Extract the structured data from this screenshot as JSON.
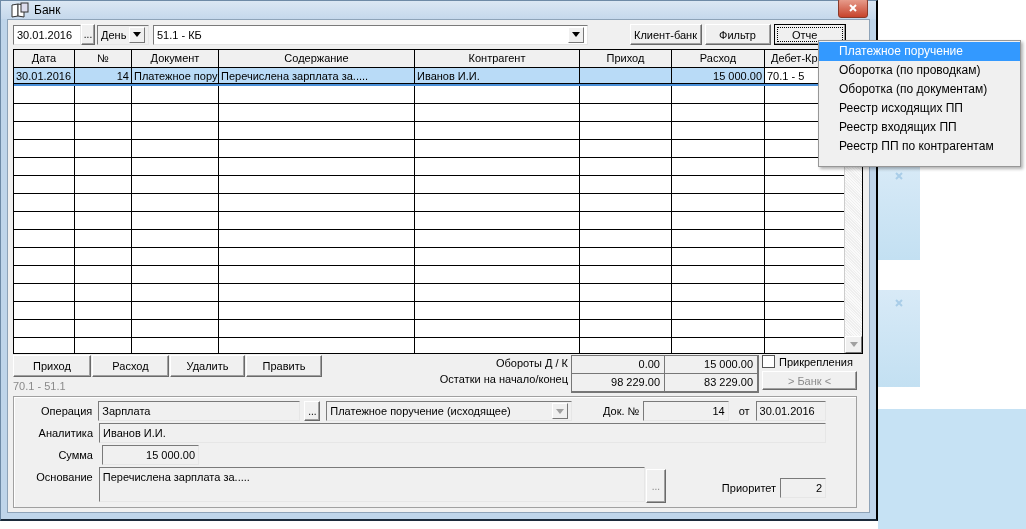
{
  "window": {
    "title": "Банк"
  },
  "toolbar": {
    "date": "30.01.2016",
    "date_button": "...",
    "period": "День",
    "account": "51.1 - КБ",
    "buttons": [
      {
        "label": "Клиент-банк",
        "focused": false
      },
      {
        "label": "Фильтр",
        "focused": false
      },
      {
        "label": "Отче",
        "focused": true
      }
    ]
  },
  "menu": {
    "items": [
      {
        "label": "Платежное поручение",
        "selected": true
      },
      {
        "label": "Оборотка (по проводкам)",
        "selected": false
      },
      {
        "label": "Оборотка (по документам)",
        "selected": false
      },
      {
        "label": "Реестр исходящих ПП",
        "selected": false
      },
      {
        "label": "Реестр входящих ПП",
        "selected": false
      },
      {
        "label": "Реестр ПП по контрагентам",
        "selected": false
      }
    ]
  },
  "table": {
    "columns": [
      "Дата",
      "№",
      "Документ",
      "Содержание",
      "Контрагент",
      "Приход",
      "Расход",
      "Дебет-Кр"
    ],
    "rows": [
      {
        "selected": true,
        "cells": [
          "30.01.2016",
          "14",
          "Платежное пору",
          "Перечислена зарплата за.....",
          "Иванов И.И.",
          null,
          "15 000.00",
          "70.1  - 5"
        ]
      }
    ]
  },
  "actions": [
    "Приход",
    "Расход",
    "Удалить",
    "Править"
  ],
  "totals": {
    "labels": [
      "Обороты Д / К",
      "Остатки на начало/конец"
    ],
    "rows": [
      [
        "0.00",
        "15 000.00"
      ],
      [
        "98 229.00",
        "83 229.00"
      ]
    ]
  },
  "attachments": {
    "label": "Прикрепления",
    "checked": false
  },
  "bank_button": {
    "label": "> Банк <",
    "disabled": true
  },
  "entry_hint": "70.1 - 51.1",
  "form": {
    "operation_label": "Операция",
    "operation": "Зарплата",
    "operation_button": "...",
    "doc_type": "Платежное поручение (исходящее)",
    "doc_type_disabled": true,
    "doc_number_label": "Док. №",
    "doc_number": "14",
    "date_label": "от",
    "date": "30.01.2016",
    "analytics_label": "Аналитика",
    "analytics": "Иванов И.И.",
    "sum_label": "Сумма",
    "sum": "15 000.00",
    "basis_label": "Основание",
    "basis": "Перечислена зарплата за.....",
    "basis_button": "...",
    "priority_label": "Приоритет",
    "priority": "2"
  }
}
